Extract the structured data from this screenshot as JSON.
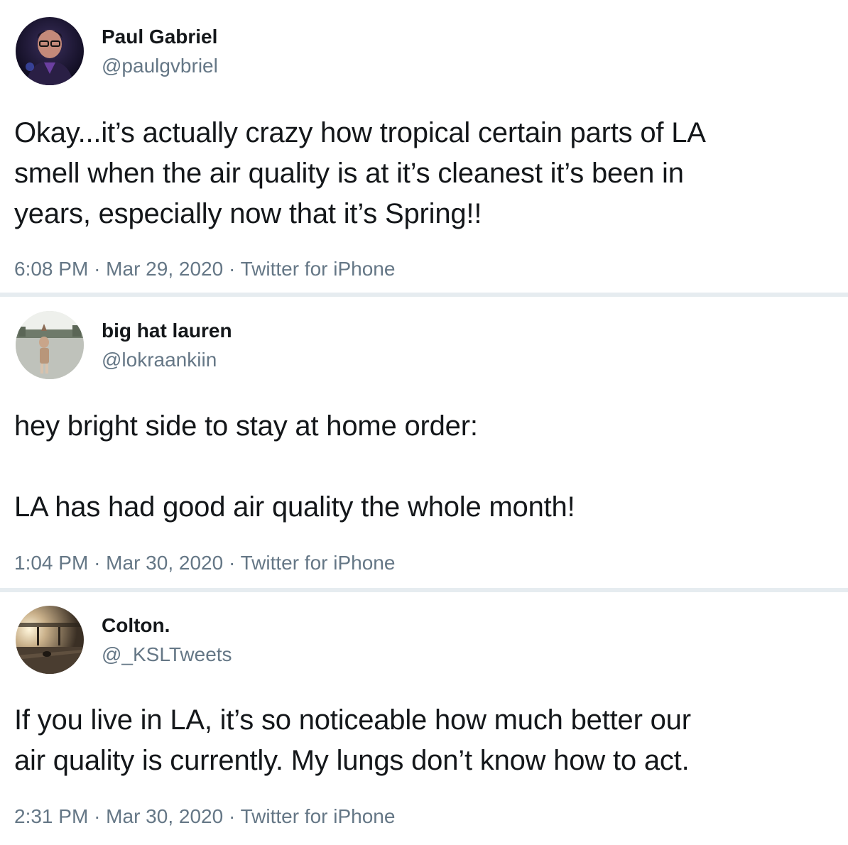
{
  "tweets": [
    {
      "name": "Paul Gabriel",
      "handle": "@paulgvbriel",
      "avatar": "avatar-photo",
      "lines": [
        "Okay...it’s actually crazy how tropical certain parts of LA",
        "smell when the air quality is at it’s cleanest it’s been in",
        "years, especially now that it’s Spring!!"
      ],
      "time": "6:08 PM",
      "date": "Mar 29, 2020",
      "source": "Twitter for iPhone",
      "dot": "·"
    },
    {
      "name": "big hat lauren",
      "handle": "@lokraankiin",
      "avatar": "avatar-photo",
      "lines": [
        "hey bright side to stay at home order:",
        "",
        "LA has had good air quality the whole month!"
      ],
      "time": "1:04 PM",
      "date": "Mar 30, 2020",
      "source": "Twitter for iPhone",
      "dot": "·"
    },
    {
      "name": "Colton.",
      "handle": "@_KSLTweets",
      "avatar": "avatar-photo",
      "lines": [
        "If you live in LA, it’s so noticeable how much better our",
        "air quality is currently. My lungs don’t know how to act."
      ],
      "time": "2:31 PM",
      "date": "Mar 30, 2020",
      "source": "Twitter for iPhone",
      "dot": "·"
    }
  ],
  "colors": {
    "text": "#14171a",
    "secondary": "#657786",
    "separator": "#e6ecf0"
  }
}
